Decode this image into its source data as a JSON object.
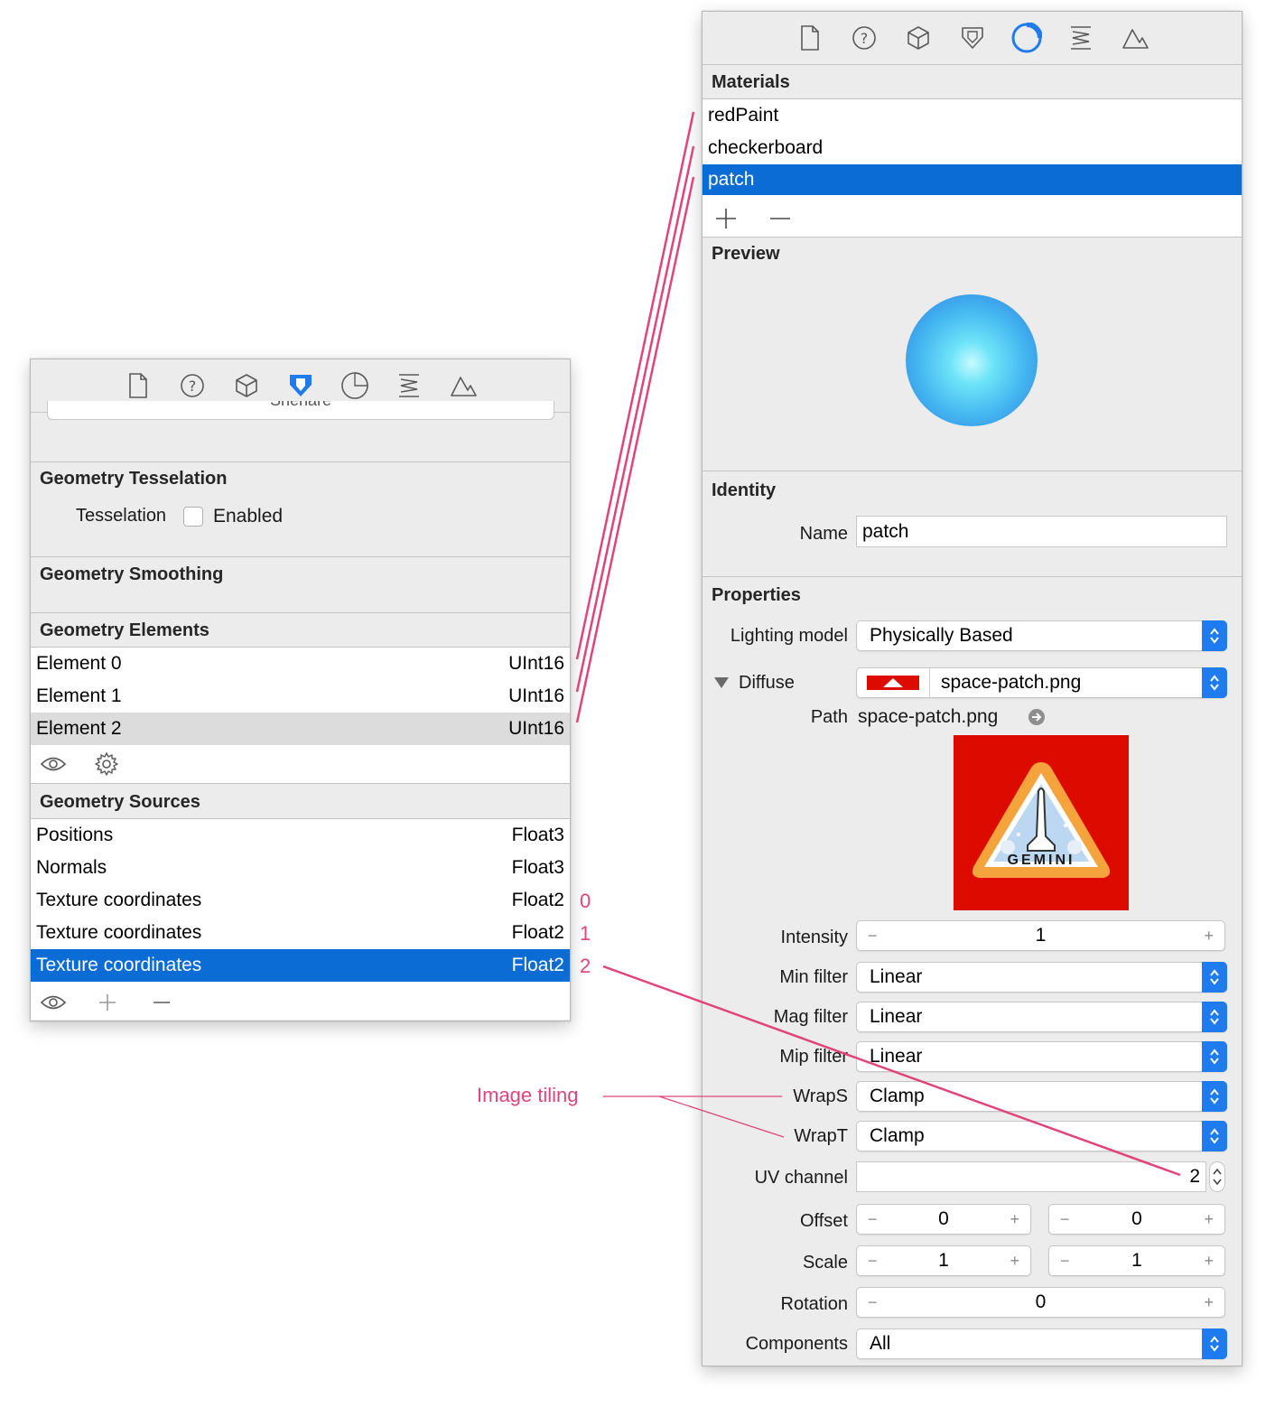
{
  "left_inspector": {
    "toolbar_icons": [
      "file-icon",
      "help-icon",
      "cube-icon",
      "attributes-icon",
      "material-icon",
      "physics-icon",
      "scene-icon"
    ],
    "active_icon": "attributes-icon",
    "partial_button_label": "Shenare",
    "tessellation": {
      "title": "Geometry Tesselation",
      "field_label": "Tesselation",
      "checkbox_label": "Enabled"
    },
    "smoothing": {
      "title": "Geometry Smoothing"
    },
    "elements": {
      "title": "Geometry Elements",
      "rows": [
        {
          "name": "Element 0",
          "type": "UInt16"
        },
        {
          "name": "Element 1",
          "type": "UInt16"
        },
        {
          "name": "Element 2",
          "type": "UInt16"
        }
      ]
    },
    "sources": {
      "title": "Geometry Sources",
      "rows": [
        {
          "name": "Positions",
          "type": "Float3"
        },
        {
          "name": "Normals",
          "type": "Float3"
        },
        {
          "name": "Texture coordinates",
          "type": "Float2"
        },
        {
          "name": "Texture coordinates",
          "type": "Float2"
        },
        {
          "name": "Texture coordinates",
          "type": "Float2"
        }
      ]
    }
  },
  "right_inspector": {
    "toolbar_icons": [
      "file-icon",
      "help-icon",
      "cube-icon",
      "attributes-icon",
      "material-icon",
      "physics-icon",
      "scene-icon"
    ],
    "active_icon": "material-icon",
    "materials": {
      "title": "Materials",
      "items": [
        "redPaint",
        "checkerboard",
        "patch"
      ],
      "selected": "patch"
    },
    "preview": {
      "title": "Preview"
    },
    "identity": {
      "title": "Identity",
      "name_label": "Name",
      "name_value": "patch"
    },
    "properties": {
      "title": "Properties",
      "lighting_label": "Lighting model",
      "lighting_value": "Physically Based",
      "diffuse_label": "Diffuse",
      "diffuse_value": "space-patch.png",
      "path_label": "Path",
      "path_value": "space-patch.png",
      "patch_text": "GEMINI",
      "intensity_label": "Intensity",
      "intensity_value": "1",
      "min_filter_label": "Min filter",
      "min_filter_value": "Linear",
      "mag_filter_label": "Mag filter",
      "mag_filter_value": "Linear",
      "mip_filter_label": "Mip filter",
      "mip_filter_value": "Linear",
      "wraps_label": "WrapS",
      "wraps_value": "Clamp",
      "wrapt_label": "WrapT",
      "wrapt_value": "Clamp",
      "uv_label": "UV channel",
      "uv_value": "2",
      "offset_label": "Offset",
      "offset_x": "0",
      "offset_y": "0",
      "scale_label": "Scale",
      "scale_x": "1",
      "scale_y": "1",
      "rotation_label": "Rotation",
      "rotation_value": "0",
      "components_label": "Components",
      "components_value": "All"
    }
  },
  "annotations": {
    "channel_numbers": [
      "0",
      "1",
      "2"
    ],
    "image_tiling": "Image tiling",
    "color": "#e0447a"
  },
  "colors": {
    "selection": "#0c6cd6",
    "accent": "#1f7cf0",
    "patch_red": "#dd0a00"
  }
}
